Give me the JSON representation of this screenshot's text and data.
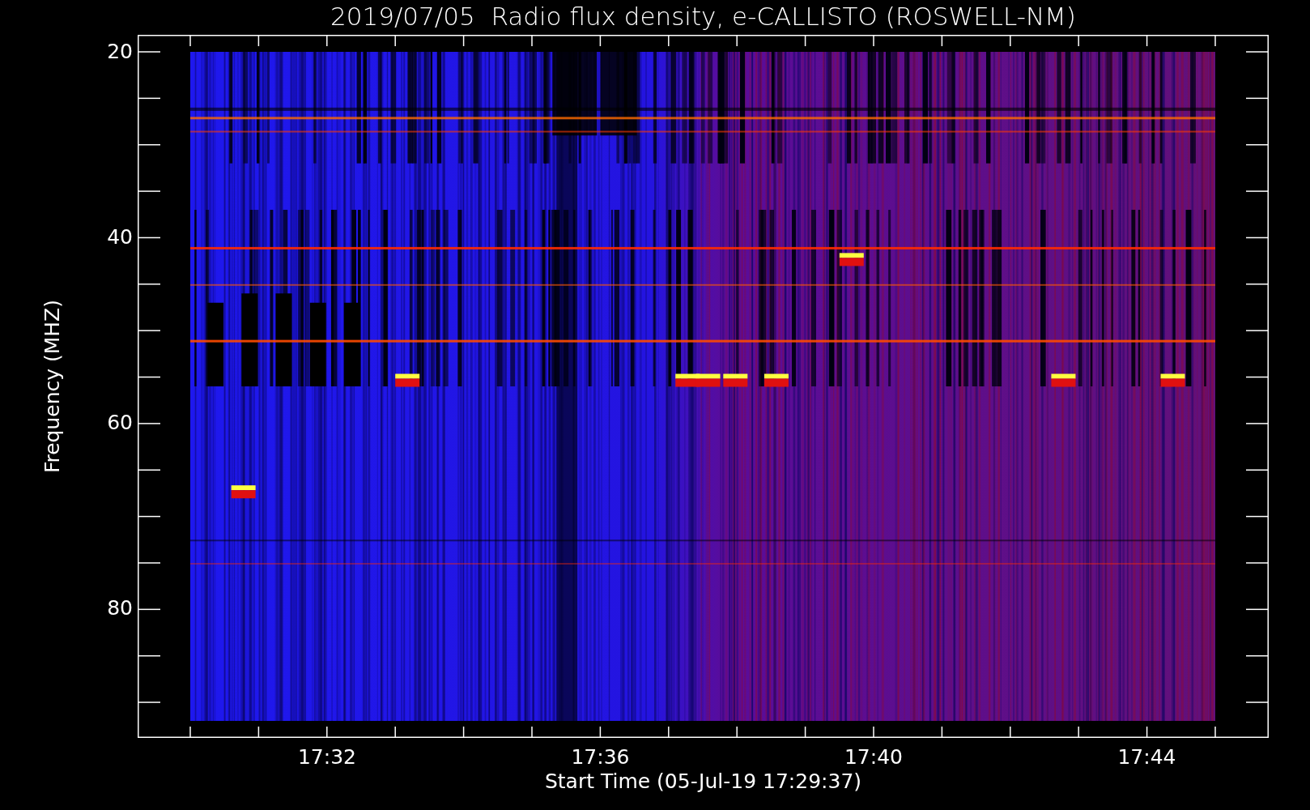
{
  "title": "2019/07/05  Radio flux density, e-CALLISTO (ROSWELL-NM)",
  "y_axis": {
    "label": "Frequency (MHZ)",
    "ticks": [
      "20",
      "40",
      "60",
      "80"
    ]
  },
  "x_axis": {
    "label": "Start Time (05-Jul-19 17:29:37)",
    "ticks": [
      "17:32",
      "17:36",
      "17:40",
      "17:44"
    ]
  }
}
